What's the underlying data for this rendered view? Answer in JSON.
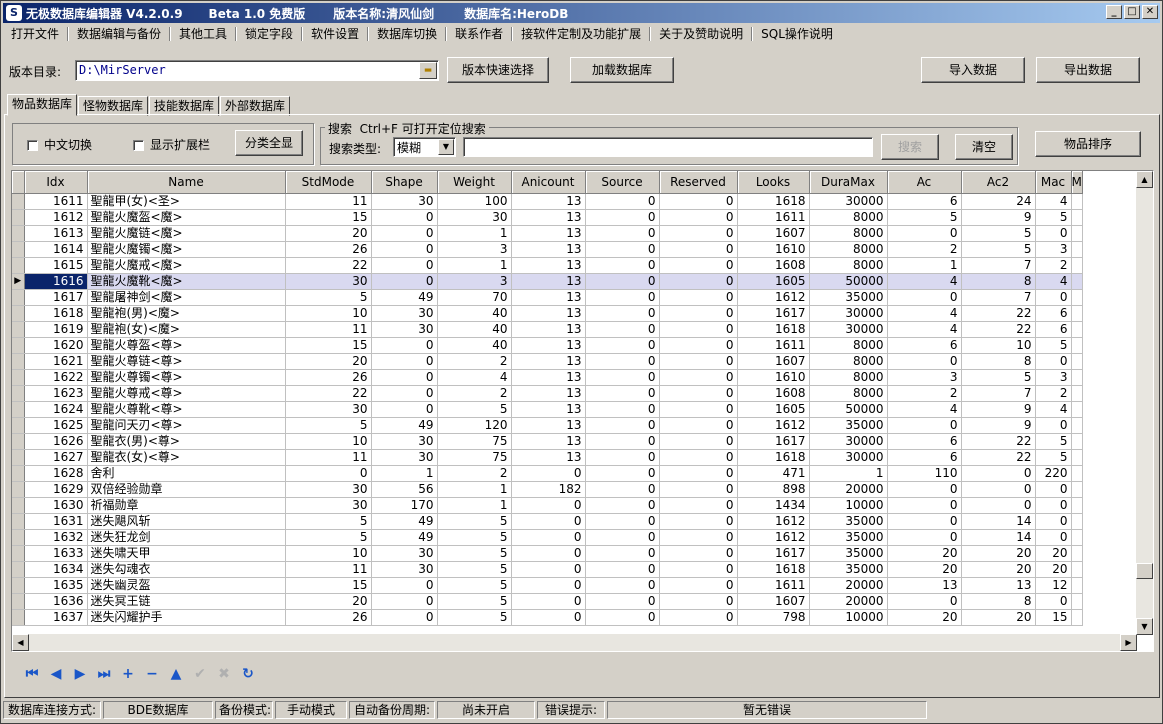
{
  "title": {
    "app": "无极数据库编辑器 V4.2.0.9",
    "beta": "Beta 1.0 免费版",
    "version_label": "版本名称:清风仙剑",
    "db_label": "数据库名:HeroDB"
  },
  "menu": [
    "打开文件",
    "数据编辑与备份",
    "其他工具",
    "锁定字段",
    "软件设置",
    "数据库切换",
    "联系作者",
    "接软件定制及功能扩展",
    "关于及赞助说明",
    "SQL操作说明"
  ],
  "toolbar": {
    "dir_label": "版本目录:",
    "dir_value": "D:\\MirServer",
    "quick_select": "版本快速选择",
    "load_db": "加载数据库",
    "import": "导入数据",
    "export": "导出数据"
  },
  "tabs": [
    "物品数据库",
    "怪物数据库",
    "技能数据库",
    "外部数据库"
  ],
  "filters": {
    "chinese_toggle": "中文切换",
    "show_extend": "显示扩展栏",
    "show_all": "分类全显",
    "search_title": "搜索  Ctrl+F 可打开定位搜索",
    "search_type_label": "搜索类型:",
    "search_type_value": "模糊",
    "search_button": "搜索",
    "clear_button": "清空",
    "sort_button": "物品排序"
  },
  "columns": [
    "Idx",
    "Name",
    "StdMode",
    "Shape",
    "Weight",
    "Anicount",
    "Source",
    "Reserved",
    "Looks",
    "DuraMax",
    "Ac",
    "Ac2",
    "Mac",
    "M"
  ],
  "rows": [
    [
      "1611",
      "聖龍甲(女)<圣>",
      "11",
      "30",
      "100",
      "13",
      "0",
      "0",
      "1618",
      "30000",
      "6",
      "24",
      "4"
    ],
    [
      "1612",
      "聖龍火魔盔<魔>",
      "15",
      "0",
      "30",
      "13",
      "0",
      "0",
      "1611",
      "8000",
      "5",
      "9",
      "5"
    ],
    [
      "1613",
      "聖龍火魔链<魔>",
      "20",
      "0",
      "1",
      "13",
      "0",
      "0",
      "1607",
      "8000",
      "0",
      "5",
      "0"
    ],
    [
      "1614",
      "聖龍火魔镯<魔>",
      "26",
      "0",
      "3",
      "13",
      "0",
      "0",
      "1610",
      "8000",
      "2",
      "5",
      "3"
    ],
    [
      "1615",
      "聖龍火魔戒<魔>",
      "22",
      "0",
      "1",
      "13",
      "0",
      "0",
      "1608",
      "8000",
      "1",
      "7",
      "2"
    ],
    [
      "1616",
      "聖龍火魔靴<魔>",
      "30",
      "0",
      "3",
      "13",
      "0",
      "0",
      "1605",
      "50000",
      "4",
      "8",
      "4"
    ],
    [
      "1617",
      "聖龍屠神剑<魔>",
      "5",
      "49",
      "70",
      "13",
      "0",
      "0",
      "1612",
      "35000",
      "0",
      "7",
      "0"
    ],
    [
      "1618",
      "聖龍袍(男)<魔>",
      "10",
      "30",
      "40",
      "13",
      "0",
      "0",
      "1617",
      "30000",
      "4",
      "22",
      "6"
    ],
    [
      "1619",
      "聖龍袍(女)<魔>",
      "11",
      "30",
      "40",
      "13",
      "0",
      "0",
      "1618",
      "30000",
      "4",
      "22",
      "6"
    ],
    [
      "1620",
      "聖龍火尊盔<尊>",
      "15",
      "0",
      "40",
      "13",
      "0",
      "0",
      "1611",
      "8000",
      "6",
      "10",
      "5"
    ],
    [
      "1621",
      "聖龍火尊链<尊>",
      "20",
      "0",
      "2",
      "13",
      "0",
      "0",
      "1607",
      "8000",
      "0",
      "8",
      "0"
    ],
    [
      "1622",
      "聖龍火尊镯<尊>",
      "26",
      "0",
      "4",
      "13",
      "0",
      "0",
      "1610",
      "8000",
      "3",
      "5",
      "3"
    ],
    [
      "1623",
      "聖龍火尊戒<尊>",
      "22",
      "0",
      "2",
      "13",
      "0",
      "0",
      "1608",
      "8000",
      "2",
      "7",
      "2"
    ],
    [
      "1624",
      "聖龍火尊靴<尊>",
      "30",
      "0",
      "5",
      "13",
      "0",
      "0",
      "1605",
      "50000",
      "4",
      "9",
      "4"
    ],
    [
      "1625",
      "聖龍问天刃<尊>",
      "5",
      "49",
      "120",
      "13",
      "0",
      "0",
      "1612",
      "35000",
      "0",
      "9",
      "0"
    ],
    [
      "1626",
      "聖龍衣(男)<尊>",
      "10",
      "30",
      "75",
      "13",
      "0",
      "0",
      "1617",
      "30000",
      "6",
      "22",
      "5"
    ],
    [
      "1627",
      "聖龍衣(女)<尊>",
      "11",
      "30",
      "75",
      "13",
      "0",
      "0",
      "1618",
      "30000",
      "6",
      "22",
      "5"
    ],
    [
      "1628",
      "舍利",
      "0",
      "1",
      "2",
      "0",
      "0",
      "0",
      "471",
      "1",
      "110",
      "0",
      "220"
    ],
    [
      "1629",
      "双倍经验勋章",
      "30",
      "56",
      "1",
      "182",
      "0",
      "0",
      "898",
      "20000",
      "0",
      "0",
      "0"
    ],
    [
      "1630",
      "祈福勋章",
      "30",
      "170",
      "1",
      "0",
      "0",
      "0",
      "1434",
      "10000",
      "0",
      "0",
      "0"
    ],
    [
      "1631",
      "迷失飓风斩",
      "5",
      "49",
      "5",
      "0",
      "0",
      "0",
      "1612",
      "35000",
      "0",
      "14",
      "0"
    ],
    [
      "1632",
      "迷失狂龙剑",
      "5",
      "49",
      "5",
      "0",
      "0",
      "0",
      "1612",
      "35000",
      "0",
      "14",
      "0"
    ],
    [
      "1633",
      "迷失啸天甲",
      "10",
      "30",
      "5",
      "0",
      "0",
      "0",
      "1617",
      "35000",
      "20",
      "20",
      "20"
    ],
    [
      "1634",
      "迷失勾魂衣",
      "11",
      "30",
      "5",
      "0",
      "0",
      "0",
      "1618",
      "35000",
      "20",
      "20",
      "20"
    ],
    [
      "1635",
      "迷失幽灵盔",
      "15",
      "0",
      "5",
      "0",
      "0",
      "0",
      "1611",
      "20000",
      "13",
      "13",
      "12"
    ],
    [
      "1636",
      "迷失冥王链",
      "20",
      "0",
      "5",
      "0",
      "0",
      "0",
      "1607",
      "20000",
      "0",
      "8",
      "0"
    ],
    [
      "1637",
      "迷失闪耀护手",
      "26",
      "0",
      "5",
      "0",
      "0",
      "0",
      "798",
      "10000",
      "20",
      "20",
      "15"
    ]
  ],
  "selected_row": 5,
  "status": {
    "conn_label": "数据库连接方式:",
    "conn_value": "BDE数据库",
    "backup_label": "备份模式:",
    "backup_value": "手动模式",
    "auto_label": "自动备份周期:",
    "auto_value": "尚未开启",
    "error_label": "错误提示:",
    "error_value": "暂无错误"
  }
}
